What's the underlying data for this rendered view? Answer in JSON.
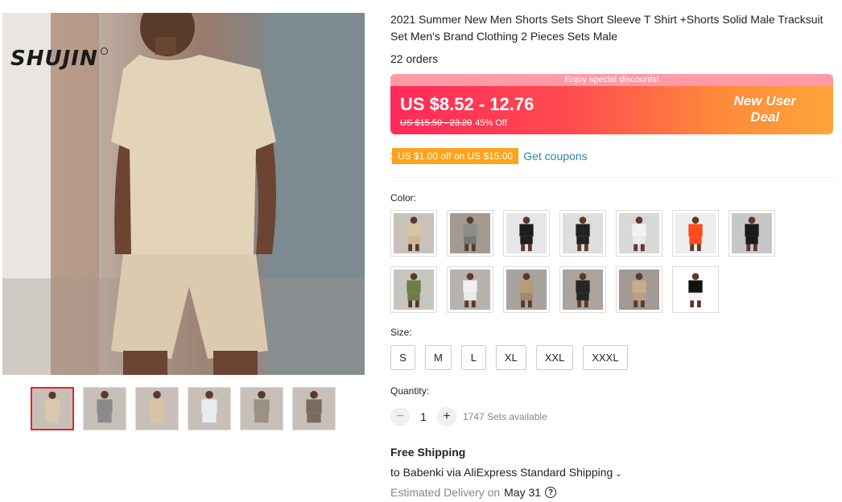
{
  "gallery": {
    "brand_logo": "SHUJIN",
    "thumbnails": [
      {
        "name": "beige-set",
        "color": "#d9c8b0"
      },
      {
        "name": "grey-set",
        "color": "#8a8a8a"
      },
      {
        "name": "detail-shots",
        "color": "#d7c3a7"
      },
      {
        "name": "size-chart",
        "color": "#e8eef0"
      },
      {
        "name": "street-grey",
        "color": "#9a9086"
      },
      {
        "name": "street-dark",
        "color": "#7a6a62"
      }
    ]
  },
  "product": {
    "title": "2021 Summer New Men Shorts Sets Short Sleeve T Shirt +Shorts Solid Male Tracksuit Set Men's Brand Clothing 2 Pieces Sets Male",
    "orders": "22 orders"
  },
  "price": {
    "strip_text": "Enjoy special discounts!",
    "current": "US $8.52 - 12.76",
    "original": "US $15.50 - 23.20",
    "discount": "45% Off",
    "badge_line1": "New User",
    "badge_line2": "Deal"
  },
  "coupon": {
    "tag": "US $1.00 off on US $15.00",
    "link": "Get coupons"
  },
  "color": {
    "label": "Color:",
    "swatches": [
      {
        "name": "beige",
        "shirt": "#d7c4a6",
        "shorts": "#cdb893",
        "bg": "#c9c2bb"
      },
      {
        "name": "grey",
        "shirt": "#8d8d8d",
        "shorts": "#777777",
        "bg": "#a49a90"
      },
      {
        "name": "black-white",
        "shirt": "#1e1e1e",
        "shorts": "#1e1e1e",
        "bg": "#e6e6e6"
      },
      {
        "name": "black",
        "shirt": "#222222",
        "shorts": "#222222",
        "bg": "#dedede"
      },
      {
        "name": "white",
        "shirt": "#f2f2f2",
        "shorts": "#eaeaea",
        "bg": "#d8d8d8"
      },
      {
        "name": "orange",
        "shirt": "#ff4a1a",
        "shorts": "#ff4a1a",
        "bg": "#eeeeee"
      },
      {
        "name": "black-dark",
        "shirt": "#1a1a1a",
        "shorts": "#1a1a1a",
        "bg": "#c7c7c7"
      },
      {
        "name": "army-green",
        "shirt": "#6e7c48",
        "shorts": "#6e7c48",
        "bg": "#c6c6be"
      },
      {
        "name": "white-street",
        "shirt": "#f0f0f0",
        "shorts": "#ebebeb",
        "bg": "#b6b2ad"
      },
      {
        "name": "khaki-street",
        "shirt": "#b49c78",
        "shorts": "#a28a68",
        "bg": "#a8a39c"
      },
      {
        "name": "black-street",
        "shirt": "#262626",
        "shorts": "#262626",
        "bg": "#aaa49c"
      },
      {
        "name": "beige-street",
        "shirt": "#c7ad8c",
        "shorts": "#bba083",
        "bg": "#a29a94"
      },
      {
        "name": "size-chart",
        "shirt": "#111111",
        "shorts": "#f2f2f2",
        "bg": "#ffffff"
      }
    ]
  },
  "size": {
    "label": "Size:",
    "options": [
      "S",
      "M",
      "L",
      "XL",
      "XXL",
      "XXXL"
    ]
  },
  "quantity": {
    "label": "Quantity:",
    "minus": "−",
    "plus": "+",
    "value": "1",
    "available": "1747 Sets available"
  },
  "shipping": {
    "title": "Free Shipping",
    "line": "to Babenki via AliExpress Standard Shipping",
    "caret": "⌄",
    "eta_label": "Estimated Delivery on",
    "eta_date": "May 31",
    "help": "?"
  },
  "colors": {
    "accent_red": "#e3242b",
    "coupon_orange": "#ffa31a",
    "link_blue": "#2a88b8"
  }
}
